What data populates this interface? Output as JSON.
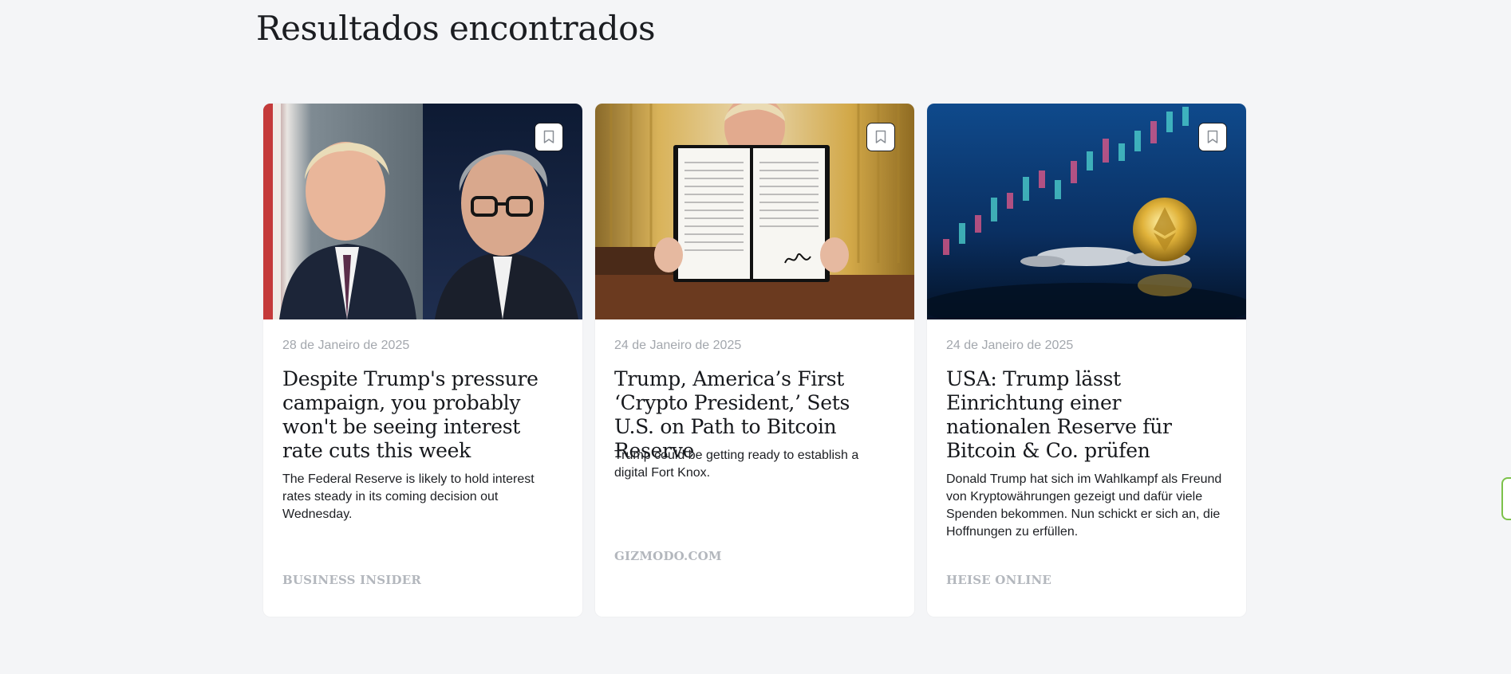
{
  "page": {
    "title": "Resultados encontrados"
  },
  "cards": [
    {
      "date": "28 de Janeiro de 2025",
      "headline": "Despite Trump's pressure campaign, you probably won't be seeing interest rate cuts this week",
      "summary": "The Federal Reserve is likely to hold interest rates steady in its coming decision out Wednesday.",
      "source": "BUSINESS INSIDER",
      "image": "photo-trump-and-powell",
      "bookmark_icon": "bookmark-icon"
    },
    {
      "date": "24 de Janeiro de 2025",
      "headline": "Trump, America’s First ‘Crypto President,’ Sets U.S. on Path to Bitcoin Reserve",
      "summary": "Trump could be getting ready to establish a digital Fort Knox.",
      "source": "GIZMODO.COM",
      "image": "photo-trump-signed-order",
      "bookmark_icon": "bookmark-icon"
    },
    {
      "date": "24 de Janeiro de 2025",
      "headline": "USA: Trump lässt Einrichtung einer nationalen Reserve für Bitcoin & Co. prüfen",
      "summary": "Donald Trump hat sich im Wahlkampf als Freund von Kryptowährungen gezeigt und dafür viele Spenden bekommen. Nun schickt er sich an, die Hoffnungen zu erfüllen.",
      "source": "HEISE ONLINE",
      "image": "photo-crypto-coins-chart",
      "bookmark_icon": "bookmark-icon"
    }
  ],
  "colors": {
    "background": "#f4f5f7",
    "card": "#ffffff",
    "text": "#16181c",
    "muted": "#a3a7ad",
    "source": "#b3b7bd",
    "edge_tab": "#7cc24a"
  }
}
